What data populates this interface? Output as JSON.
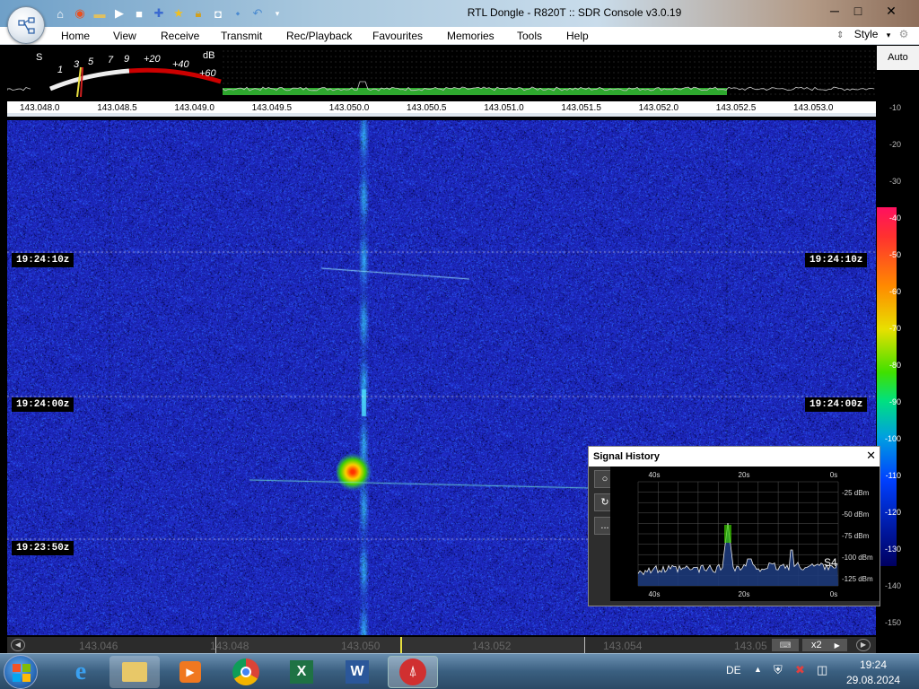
{
  "window": {
    "title": "RTL Dongle - R820T :: SDR Console v3.0.19",
    "minimize": "─",
    "maximize": "□",
    "close": "✕"
  },
  "menu": {
    "items": [
      "Home",
      "View",
      "Receive",
      "Transmit",
      "Rec/Playback",
      "Favourites",
      "Memories",
      "Tools",
      "Help"
    ],
    "style_label": "Style"
  },
  "smeter": {
    "scale": [
      "S",
      "1",
      "3",
      "5",
      "7",
      "9",
      "+20",
      "+40",
      "+60"
    ],
    "unit": "dB"
  },
  "frequency_axis": [
    "143.048.0",
    "143.048.5",
    "143.049.0",
    "143.049.5",
    "143.050.0",
    "143.050.5",
    "143.051.0",
    "143.051.5",
    "143.052.0",
    "143.052.5",
    "143.053.0"
  ],
  "waterfall": {
    "time_labels": [
      "19:24:10z",
      "19:24:00z",
      "19:23:50z"
    ]
  },
  "bottom_scale": [
    "143.046",
    "143.048",
    "143.050",
    "143.052",
    "143.054",
    "143.05"
  ],
  "bottom_controls": {
    "zoom": "x2"
  },
  "right_scale": {
    "auto_label": "Auto",
    "ticks": [
      "-10",
      "-20",
      "-30",
      "-40",
      "-50",
      "-60",
      "-70",
      "-80",
      "-90",
      "-100",
      "-110",
      "-120",
      "-130",
      "-140",
      "-150"
    ]
  },
  "signal_history": {
    "title": "Signal History",
    "close": "✕",
    "x_top": [
      "40s",
      "20s",
      "0s"
    ],
    "x_bottom": [
      "40s",
      "20s",
      "0s"
    ],
    "y_labels": [
      "-25 dBm",
      "-50 dBm",
      "-75 dBm",
      "-100 dBm",
      "-125 dBm"
    ],
    "s_reading": "S4",
    "buttons": [
      "",
      "↻",
      "..."
    ]
  },
  "taskbar": {
    "language": "DE",
    "time": "19:24",
    "date": "29.08.2024"
  },
  "colors": {
    "waterfall_bg": "#1a22a8",
    "signal_peak": "#3cd000",
    "spectrum_fill": "#2ea82e"
  }
}
